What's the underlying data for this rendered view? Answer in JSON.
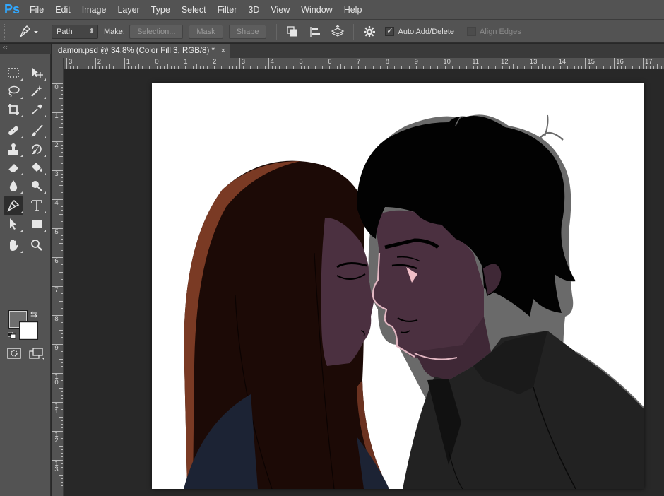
{
  "app": {
    "logo": "Ps"
  },
  "menu": [
    "File",
    "Edit",
    "Image",
    "Layer",
    "Type",
    "Select",
    "Filter",
    "3D",
    "View",
    "Window",
    "Help"
  ],
  "options": {
    "tool_preset_icon": "pen-tool-icon",
    "mode_select": "Path",
    "make_label": "Make:",
    "selection_button": "Selection...",
    "mask_button": "Mask",
    "shape_button": "Shape",
    "auto_add_delete": {
      "label": "Auto Add/Delete",
      "checked": true
    },
    "align_edges": {
      "label": "Align Edges",
      "checked": false,
      "enabled": false
    }
  },
  "document": {
    "tab_title": "damon.psd @ 34.8% (Color Fill 3, RGB/8) *",
    "close_glyph": "×"
  },
  "rulers": {
    "horizontal": [
      "3",
      "2",
      "1",
      "0",
      "1",
      "2",
      "3",
      "4",
      "5",
      "6",
      "7",
      "8",
      "9",
      "10",
      "11",
      "12",
      "13",
      "14",
      "15",
      "16",
      "17"
    ],
    "vertical": [
      "0",
      "1",
      "2",
      "3",
      "4",
      "5",
      "6",
      "7",
      "8",
      "9",
      "1\n0",
      "1\n1",
      "1\n2",
      "1\n3"
    ]
  },
  "colors": {
    "foreground": "#6e6e6e",
    "background": "#ffffff",
    "ui_panel": "#535353",
    "pasteboard": "#282828"
  },
  "tools": [
    "rectangular-marquee-tool-icon",
    "move-tool-icon",
    "lasso-tool-icon",
    "magic-wand-tool-icon",
    "crop-tool-icon",
    "eyedropper-tool-icon",
    "spot-healing-brush-tool-icon",
    "brush-tool-icon",
    "clone-stamp-tool-icon",
    "history-brush-tool-icon",
    "eraser-tool-icon",
    "paint-bucket-tool-icon",
    "blur-tool-icon",
    "dodge-tool-icon",
    "pen-tool-icon",
    "type-tool-icon",
    "path-selection-tool-icon",
    "rectangle-tool-icon",
    "hand-tool-icon",
    "zoom-tool-icon"
  ]
}
